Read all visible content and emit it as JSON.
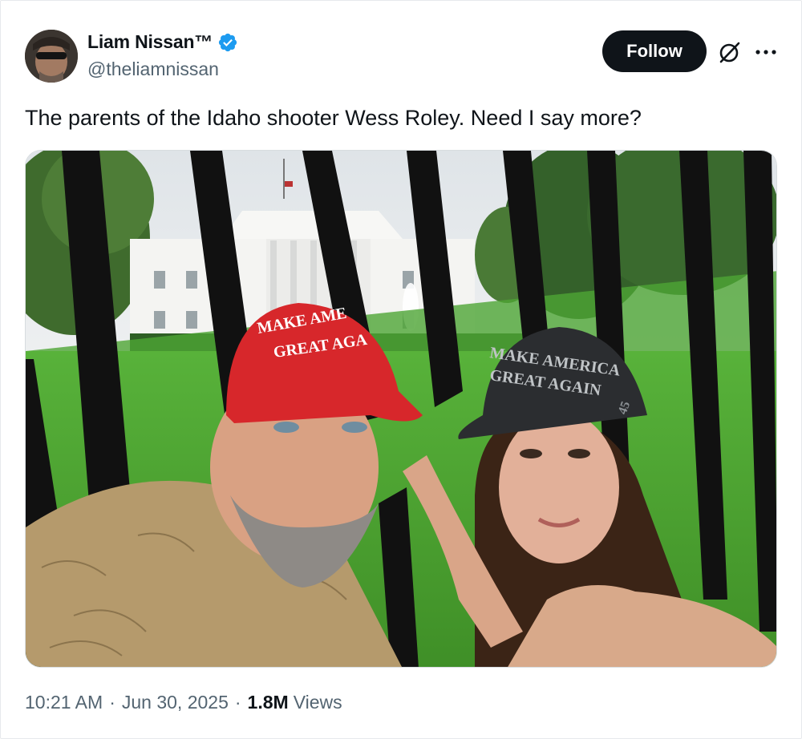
{
  "tweet": {
    "author": {
      "display_name": "Liam Nissan™",
      "handle": "@theliamnissan",
      "verified": true
    },
    "follow_label": "Follow",
    "text": "The parents of the Idaho shooter Wess Roley. Need I say more?",
    "media": {
      "red_cap_text_line1": "MAKE AME",
      "red_cap_text_line2": "GREAT AGA",
      "black_cap_text_line1": "MAKE AMERICA",
      "black_cap_text_line2": "GREAT AGAIN",
      "cap_side_number": "45"
    },
    "time": "10:21 AM",
    "date": "Jun 30, 2025",
    "views_count": "1.8M",
    "views_label": "Views"
  },
  "icons": {
    "verified": "verified-badge-icon",
    "grok": "grok-icon",
    "more": "more-dots-icon"
  },
  "colors": {
    "follow_bg": "#0f1419",
    "verified_blue": "#1d9bf0",
    "secondary_text": "#536471"
  }
}
